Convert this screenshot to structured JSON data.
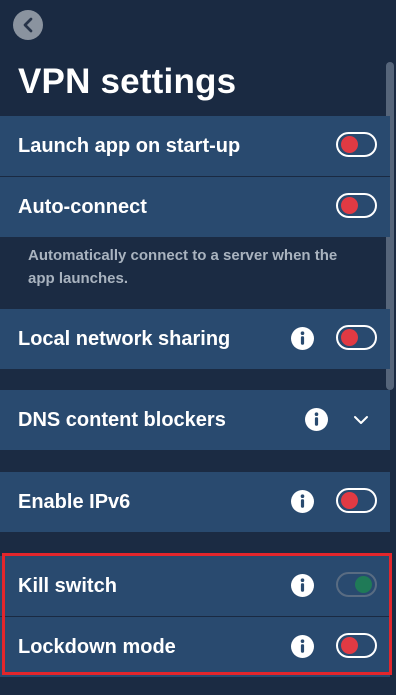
{
  "header": {
    "title": "VPN settings"
  },
  "settings": {
    "launch_on_startup": {
      "label": "Launch app on start-up",
      "enabled": false
    },
    "auto_connect": {
      "label": "Auto-connect",
      "enabled": false,
      "description": "Automatically connect to a server when the app launches."
    },
    "local_network_sharing": {
      "label": "Local network sharing",
      "enabled": false
    },
    "dns_content_blockers": {
      "label": "DNS content blockers",
      "expanded": false
    },
    "enable_ipv6": {
      "label": "Enable IPv6",
      "enabled": false
    },
    "kill_switch": {
      "label": "Kill switch",
      "enabled": true,
      "locked": true
    },
    "lockdown_mode": {
      "label": "Lockdown mode",
      "enabled": false
    }
  },
  "icons": {
    "back": "back-icon",
    "info": "info-icon",
    "chevron": "chevron-down-icon"
  },
  "colors": {
    "background": "#1b2b43",
    "row_background": "#294a6f",
    "toggle_off_knob": "#e13a43",
    "toggle_on_knob": "#1f7d56",
    "highlight": "#e3262c"
  }
}
